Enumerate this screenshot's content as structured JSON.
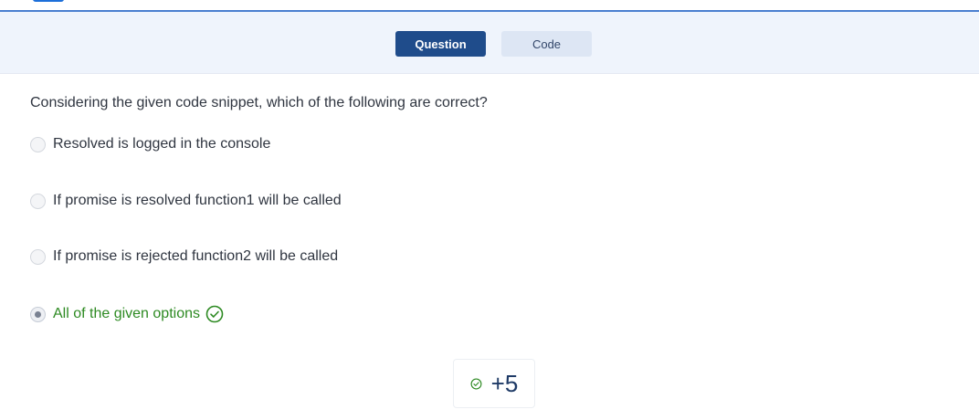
{
  "tabs": {
    "question_label": "Question",
    "code_label": "Code"
  },
  "question": {
    "prompt": "Considering the given code snippet, which of the following are correct?",
    "options": [
      {
        "label": "Resolved is logged in the console",
        "selected": false
      },
      {
        "label": "If promise is resolved function1 will be called",
        "selected": false
      },
      {
        "label": "If promise is rejected function2 will be called",
        "selected": false
      },
      {
        "label": "All of the given options",
        "selected": true,
        "correct": true
      }
    ]
  },
  "score": {
    "value": "+5",
    "icon": "check-circle-icon"
  },
  "colors": {
    "accent": "#1f4c8b",
    "correct": "#2d8a22",
    "tabbar_bg": "#eff4fc"
  }
}
